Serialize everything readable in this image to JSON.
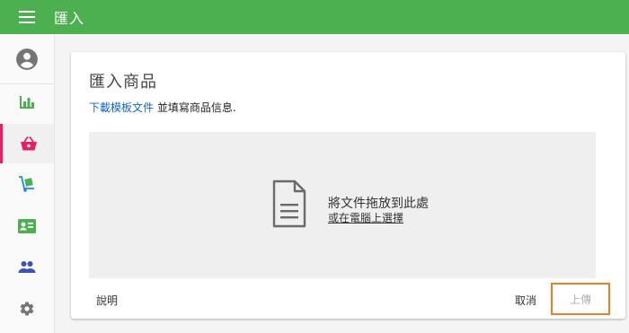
{
  "appbar": {
    "title": "匯入",
    "menu_icon": "hamburger-menu-icon",
    "color": "#4caf50"
  },
  "sidebar": {
    "items": [
      {
        "icon": "account-circle-icon"
      },
      {
        "icon": "bar-chart-icon"
      },
      {
        "icon": "shopping-basket-icon",
        "active": true
      },
      {
        "icon": "dolly-cart-icon"
      },
      {
        "icon": "contact-card-icon"
      },
      {
        "icon": "people-icon"
      },
      {
        "icon": "gear-icon"
      }
    ],
    "icon_color": "#4caf50",
    "active_color": "#e91e63"
  },
  "dialog": {
    "title": "匯入商品",
    "template_link": "下載模板文件",
    "instruction": " 並填寫商品信息.",
    "dropzone": {
      "main_text": "將文件拖放到此處",
      "browse_link": "或在電腦上選擇"
    },
    "help_label": "說明",
    "cancel_label": "取消",
    "upload_label": "上傳",
    "upload_disabled": true,
    "highlight_color": "#e8811f"
  }
}
